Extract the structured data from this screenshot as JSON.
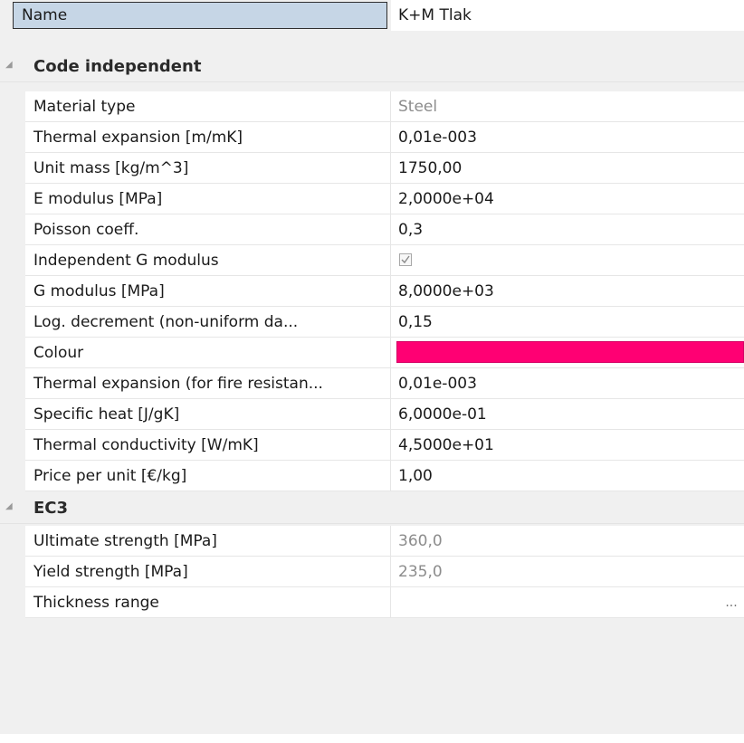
{
  "name_row": {
    "label": "Name",
    "value": "K+M Tlak"
  },
  "sections": [
    {
      "title": "Code independent"
    },
    {
      "title": "EC3"
    }
  ],
  "code_independent": {
    "material_type": {
      "label": "Material type",
      "value": "Steel"
    },
    "thermal_expansion": {
      "label": "Thermal expansion  [m/mK]",
      "value": "0,01e-003"
    },
    "unit_mass": {
      "label": "Unit mass [kg/m^3]",
      "value": "1750,00"
    },
    "e_modulus": {
      "label": "E modulus [MPa]",
      "value": "2,0000e+04"
    },
    "poisson": {
      "label": "Poisson coeff.",
      "value": "0,3"
    },
    "independent_g": {
      "label": "Independent G modulus",
      "checked": true
    },
    "g_modulus": {
      "label": "G modulus [MPa]",
      "value": "8,0000e+03"
    },
    "log_decrement": {
      "label": "Log. decrement (non-uniform da...",
      "value": "0,15"
    },
    "colour": {
      "label": "Colour",
      "color": "#ff0073"
    },
    "thermal_expansion_fire": {
      "label": "Thermal expansion (for fire resistan...",
      "value": "0,01e-003"
    },
    "specific_heat": {
      "label": "Specific heat [J/gK]",
      "value": "6,0000e-01"
    },
    "thermal_conductivity": {
      "label": "Thermal conductivity [W/mK]",
      "value": "4,5000e+01"
    },
    "price_per_unit": {
      "label": "Price per unit [€/kg]",
      "value": "1,00"
    }
  },
  "ec3": {
    "ultimate_strength": {
      "label": "Ultimate strength [MPa]",
      "value": "360,0"
    },
    "yield_strength": {
      "label": "Yield strength [MPa]",
      "value": "235,0"
    },
    "thickness_range": {
      "label": "Thickness range",
      "button": "..."
    }
  },
  "icons": {
    "section_collapse": "collapse-triangle-icon",
    "checkbox": "checkmark-icon"
  }
}
